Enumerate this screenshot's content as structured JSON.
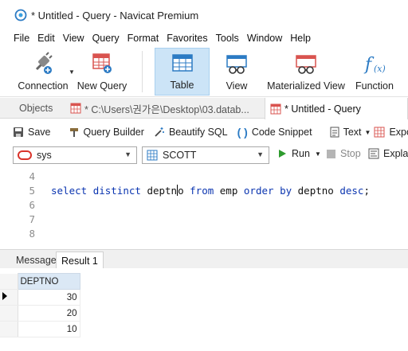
{
  "window": {
    "title": "* Untitled - Query - Navicat Premium"
  },
  "menu": [
    "File",
    "Edit",
    "View",
    "Query",
    "Format",
    "Favorites",
    "Tools",
    "Window",
    "Help"
  ],
  "toolbar": {
    "connection": "Connection",
    "new_query": "New Query",
    "table": "Table",
    "view": "View",
    "materialized_view": "Materialized View",
    "function": "Function"
  },
  "tabs": {
    "objects": "Objects",
    "file_tab": "* C:\\Users\\권가은\\Desktop\\03.datab...",
    "query_tab": "* Untitled - Query"
  },
  "query_toolbar": {
    "save": "Save",
    "query_builder": "Query Builder",
    "beautify": "Beautify SQL",
    "snippet": "Code Snippet",
    "text": "Text",
    "export": "Expor",
    "explain": "Explai"
  },
  "selectors": {
    "connection": "sys",
    "schema": "SCOTT",
    "run": "Run",
    "stop": "Stop"
  },
  "editor": {
    "line_numbers": [
      "4",
      "5",
      "6",
      "7",
      "8"
    ],
    "tokens": {
      "select": "select",
      "distinct": "distinct",
      "col1_a": "deptn",
      "col1_b": "o",
      "from": "from",
      "table": "emp",
      "order": "order",
      "by": "by",
      "col2": "deptno",
      "desc": "desc",
      "end": ";"
    }
  },
  "result_tabs": {
    "message": "Message",
    "result": "Result 1"
  },
  "results": {
    "columns": [
      "DEPTNO"
    ],
    "rows": [
      [
        "30"
      ],
      [
        "20"
      ],
      [
        "10"
      ]
    ]
  },
  "colors": {
    "keyword": "#0b35b0",
    "selected_tab": "#cce4f7",
    "column_header": "#dbe8f5",
    "connection_icon": "#d9342b",
    "run_green": "#2e9b2e"
  }
}
